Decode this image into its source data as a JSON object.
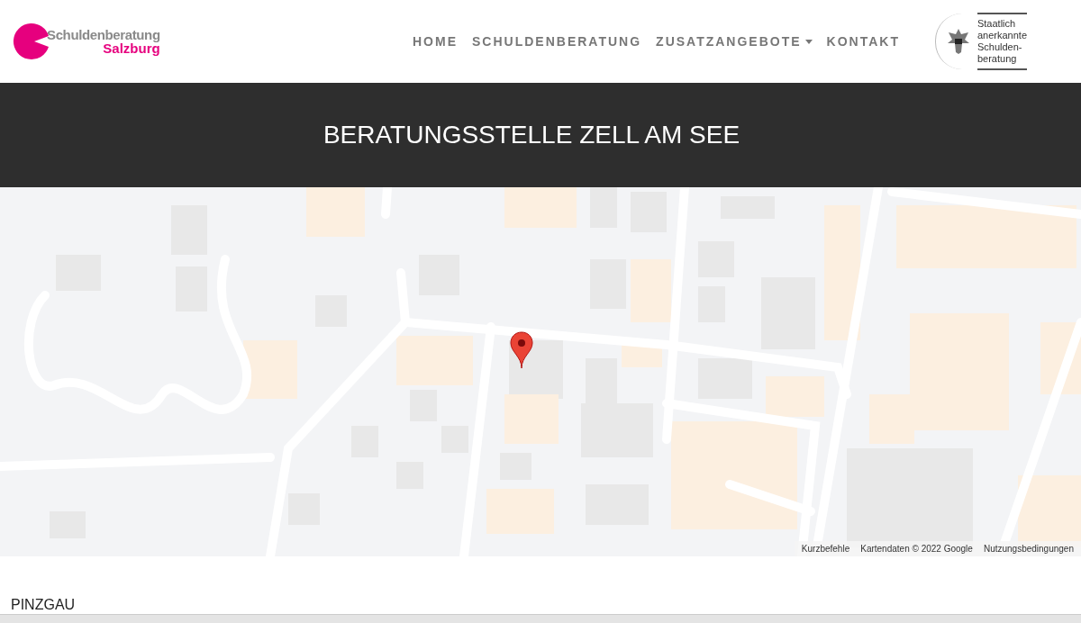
{
  "logo": {
    "line1": "Schuldenberatung",
    "line2": "Salzburg"
  },
  "nav": [
    {
      "label": "HOME",
      "dropdown": false
    },
    {
      "label": "SCHULDENBERATUNG",
      "dropdown": false
    },
    {
      "label": "ZUSATZANGEBOTE",
      "dropdown": true
    },
    {
      "label": "KONTAKT",
      "dropdown": false
    }
  ],
  "badge": {
    "lines": [
      "Staatlich",
      "anerkannte",
      "Schulden-",
      "beratung"
    ]
  },
  "banner": {
    "title": "BERATUNGSSTELLE ZELL AM SEE"
  },
  "map": {
    "attribution": [
      "Kurzbefehle",
      "Kartendaten © 2022 Google",
      "Nutzungsbedingungen"
    ]
  },
  "section": {
    "heading": "PINZGAU"
  }
}
